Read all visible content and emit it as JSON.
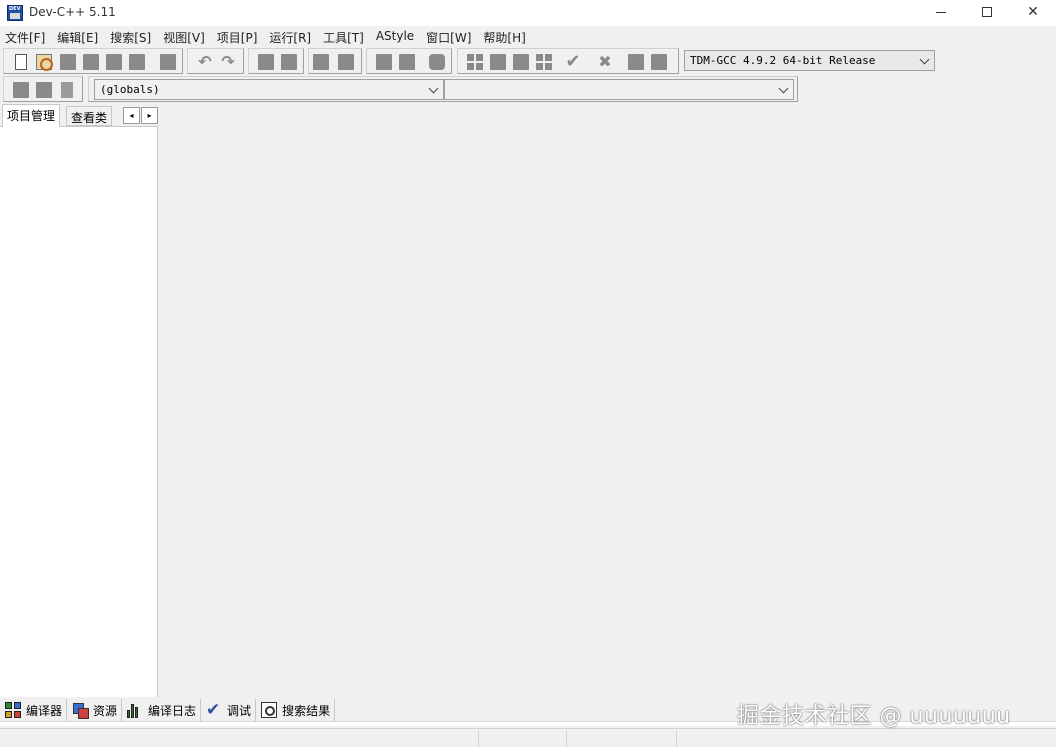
{
  "window": {
    "title": "Dev-C++ 5.11",
    "controls": {
      "minimize": "minimize",
      "maximize": "maximize",
      "close": "✕"
    }
  },
  "menu": [
    "文件[F]",
    "编辑[E]",
    "搜索[S]",
    "视图[V]",
    "项目[P]",
    "运行[R]",
    "工具[T]",
    "AStyle",
    "窗口[W]",
    "帮助[H]"
  ],
  "toolbar": {
    "compiler_selected": "TDM-GCC 4.9.2 64-bit Release",
    "scope_selected": "(globals)",
    "member_selected": ""
  },
  "left_panel": {
    "tabs": [
      "项目管理",
      "查看类"
    ],
    "scroll_left": "◂",
    "scroll_right": "▸"
  },
  "bottom_tabs": [
    {
      "label": "编译器",
      "icon": "compiler-grid-icon"
    },
    {
      "label": "资源",
      "icon": "resources-icon"
    },
    {
      "label": "编译日志",
      "icon": "compile-log-chart-icon"
    },
    {
      "label": "调试",
      "icon": "debug-check-icon"
    },
    {
      "label": "搜索结果",
      "icon": "search-results-icon"
    }
  ],
  "watermark": "掘金技术社区 @ uuuuuuu",
  "colors": {
    "background": "#f0f0f0",
    "panel": "#ffffff",
    "icon_gray": "#8a8a8a",
    "app_icon_blue": "#1f4ea6"
  }
}
